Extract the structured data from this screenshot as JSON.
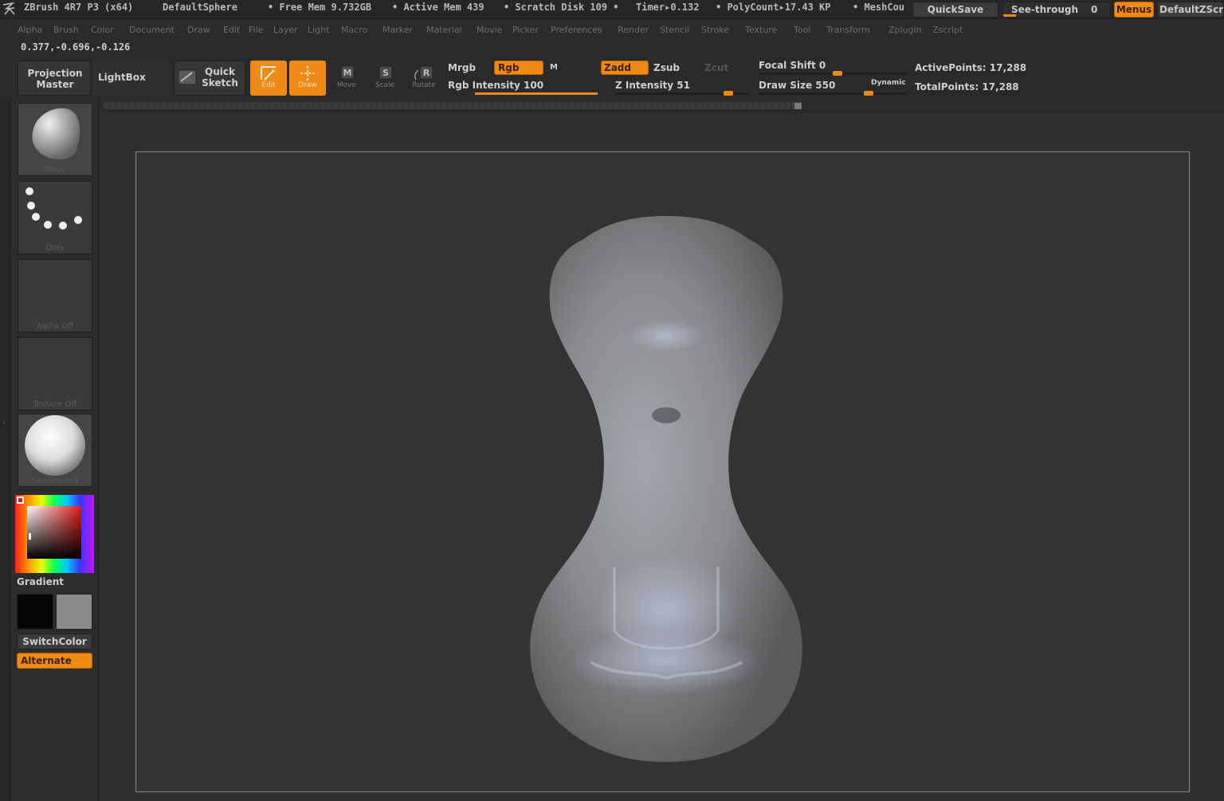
{
  "titlebar": {
    "app": "ZBrush 4R7 P3 (x64)",
    "document": "DefaultSphere",
    "free_mem": "• Free Mem 9.732GB",
    "active_mem": "• Active Mem 439",
    "scratch_disk": "• Scratch Disk 109 •",
    "timer": "Timer▸0.132",
    "polycount": "• PolyCount▸17.43 KP",
    "meshcount": "• MeshCou",
    "quicksave": "QuickSave",
    "see_through": "See-through",
    "see_through_value": "0",
    "menus": "Menus",
    "default_zscript": "DefaultZScr"
  },
  "menu": [
    "Alpha",
    "Brush",
    "Color",
    "Document",
    "Draw",
    "Edit",
    "File",
    "Layer",
    "Light",
    "Macro",
    "Marker",
    "Material",
    "Movie",
    "Picker",
    "Preferences",
    "Render",
    "Stencil",
    "Stroke",
    "Texture",
    "Tool",
    "Transform",
    "Zplugin",
    "Zscript"
  ],
  "coords": "0.377,-0.696,-0.126",
  "toolbar": {
    "projection_master": "Projection Master",
    "lightbox": "LightBox",
    "quick_sketch": "Quick Sketch",
    "edit": "Edit",
    "draw": "Draw",
    "move": "Move",
    "scale": "Scale",
    "rotate": "Rotate",
    "mrgb": "Mrgb",
    "rgb": "Rgb",
    "m": "M",
    "rgb_intensity": "Rgb Intensity 100",
    "zadd": "Zadd",
    "zsub": "Zsub",
    "zcut": "Zcut",
    "z_intensity": "Z Intensity 51",
    "focal_shift": "Focal Shift 0",
    "draw_size": "Draw Size 550",
    "dynamic": "Dynamic",
    "active_points": "ActivePoints: 17,288",
    "total_points": "TotalPoints: 17,288"
  },
  "levels": {
    "rgb_intensity": 1.0,
    "z_intensity": 0.51,
    "focal_shift": 0.5,
    "draw_size": 0.55,
    "see_through": 0.0
  },
  "shelf": {
    "brush": "Move",
    "stroke": "Dots",
    "alpha": "Alpha Off",
    "texture": "Texture Off",
    "material": "SkinShade4",
    "gradient": "Gradient",
    "switchcolor": "SwitchColor",
    "alternate": "Alternate"
  },
  "colors": {
    "accent": "#f08a16",
    "panel": "#2c2c2c",
    "canvas": "#333333",
    "mesh": "#8c8c8c"
  }
}
